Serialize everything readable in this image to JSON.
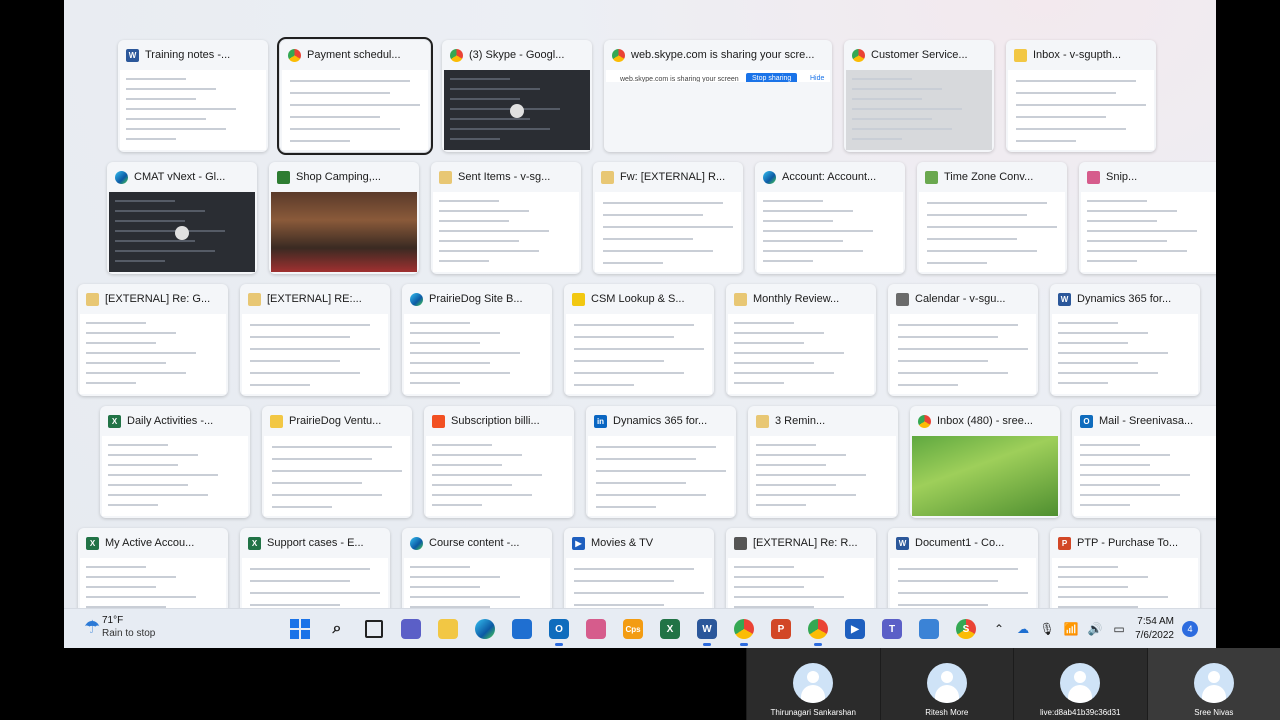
{
  "windows": {
    "row1": [
      {
        "title": "Training notes -...",
        "app": "word-icon",
        "color": "#2b579a",
        "letter": "W"
      },
      {
        "title": "Payment schedul...",
        "app": "chrome-icon",
        "color": "#8a4fd1",
        "letter": "",
        "selected": true
      },
      {
        "title": "(3) Skype - Googl...",
        "app": "chrome-icon",
        "color": "#8a4fd1",
        "letter": "",
        "dark": true
      },
      {
        "title": "web.skype.com is sharing your scre...",
        "app": "chrome-icon",
        "color": "#4285f4",
        "letter": "",
        "wide": true,
        "banner_text": "web.skype.com is sharing your screen",
        "stop_label": "Stop sharing",
        "hide_label": "Hide"
      },
      {
        "title": "Customer Service...",
        "app": "chrome-icon",
        "color": "#4285f4",
        "letter": "",
        "gray": true
      },
      {
        "title": "Inbox - v-sgupth...",
        "app": "folder-icon",
        "color": "#f2c744",
        "letter": ""
      }
    ],
    "row2": [
      {
        "title": "CMAT vNext - Gl...",
        "app": "edge-icon",
        "color": "#0c8ad6",
        "letter": "",
        "dark": true
      },
      {
        "title": "Shop Camping,...",
        "app": "rei-icon",
        "color": "#2e7d32",
        "letter": "",
        "photo": true
      },
      {
        "title": "Sent Items - v-sg...",
        "app": "mail-icon",
        "color": "#e8c774",
        "letter": ""
      },
      {
        "title": "Fw: [EXTERNAL] R...",
        "app": "mail-icon",
        "color": "#e8c774",
        "letter": ""
      },
      {
        "title": "Account: Account...",
        "app": "edge-icon",
        "color": "#0c8ad6",
        "letter": ""
      },
      {
        "title": "Time Zone Conv...",
        "app": "timezone-icon",
        "color": "#6aa84f",
        "letter": ""
      },
      {
        "title": "Snip...",
        "app": "snip-icon",
        "color": "#d65c8c",
        "letter": ""
      }
    ],
    "row3": [
      {
        "title": "[EXTERNAL] Re: G...",
        "app": "mail-icon",
        "color": "#e8c774",
        "letter": ""
      },
      {
        "title": "[EXTERNAL] RE:...",
        "app": "mail-icon",
        "color": "#e8c774",
        "letter": ""
      },
      {
        "title": "PrairieDog Site B...",
        "app": "edge-icon",
        "color": "#0c8ad6",
        "letter": ""
      },
      {
        "title": "CSM Lookup & S...",
        "app": "powerbi-icon",
        "color": "#f2c811",
        "letter": ""
      },
      {
        "title": "Monthly Review...",
        "app": "mail-icon",
        "color": "#e8c774",
        "letter": ""
      },
      {
        "title": "Calendar - v-sgu...",
        "app": "calendar-icon",
        "color": "#6b6b6b",
        "letter": ""
      },
      {
        "title": "Dynamics 365 for...",
        "app": "word-icon",
        "color": "#2b579a",
        "letter": "W"
      }
    ],
    "row4": [
      {
        "title": "Daily Activities -...",
        "app": "excel-icon",
        "color": "#217346",
        "letter": "X"
      },
      {
        "title": "PrairieDog Ventu...",
        "app": "folder-icon",
        "color": "#f2c744",
        "letter": ""
      },
      {
        "title": "Subscription billi...",
        "app": "microsoft-icon",
        "color": "#f25022",
        "letter": ""
      },
      {
        "title": "Dynamics 365 for...",
        "app": "linkedin-icon",
        "color": "#0a66c2",
        "letter": "in"
      },
      {
        "title": "3 Remin...",
        "app": "bell-icon",
        "color": "#e8c774",
        "letter": ""
      },
      {
        "title": "Inbox (480) - sree...",
        "app": "chrome-icon",
        "color": "#4285f4",
        "letter": "",
        "green": true
      },
      {
        "title": "Mail - Sreenivasa...",
        "app": "outlook-icon",
        "color": "#0f6cbd",
        "letter": "O"
      }
    ],
    "row5": [
      {
        "title": "My Active Accou...",
        "app": "excel-icon",
        "color": "#217346",
        "letter": "X"
      },
      {
        "title": "Support cases - E...",
        "app": "excel-icon",
        "color": "#217346",
        "letter": "X"
      },
      {
        "title": "Course content -...",
        "app": "edge-icon",
        "color": "#0c8ad6",
        "letter": ""
      },
      {
        "title": "Movies & TV",
        "app": "movies-icon",
        "color": "#1e5fbf",
        "letter": "▶"
      },
      {
        "title": "[EXTERNAL] Re: R...",
        "app": "document-icon",
        "color": "#555555",
        "letter": ""
      },
      {
        "title": "Document1 - Co...",
        "app": "word-icon",
        "color": "#2b579a",
        "letter": "W"
      },
      {
        "title": "PTP - Purchase To...",
        "app": "powerpoint-icon",
        "color": "#d24726",
        "letter": "P"
      }
    ]
  },
  "taskbar": {
    "weather_temp": "71°F",
    "weather_condition": "Rain to stop",
    "time": "7:54 AM",
    "date": "7/6/2022",
    "notifications": "4",
    "apps": [
      {
        "name": "start-icon",
        "color": "#1a73e8",
        "label": ""
      },
      {
        "name": "search-icon",
        "color": "#222222",
        "label": ""
      },
      {
        "name": "task-view-icon",
        "color": "#222222",
        "label": ""
      },
      {
        "name": "teams-chat-icon",
        "color": "#5b5fc7",
        "label": ""
      },
      {
        "name": "file-explorer-icon",
        "color": "#f2c744",
        "label": ""
      },
      {
        "name": "edge-icon",
        "color": "#0c8ad6",
        "label": ""
      },
      {
        "name": "store-icon",
        "color": "#1f6fd1",
        "label": ""
      },
      {
        "name": "outlook-icon",
        "color": "#0f6cbd",
        "label": "O",
        "active": true
      },
      {
        "name": "snipping-tool-icon",
        "color": "#d65c8c",
        "label": ""
      },
      {
        "name": "cps-icon",
        "color": "#f39c12",
        "label": "Cps"
      },
      {
        "name": "excel-icon",
        "color": "#217346",
        "label": "X"
      },
      {
        "name": "word-icon",
        "color": "#2b579a",
        "label": "W",
        "active": true
      },
      {
        "name": "chrome-icon",
        "color": "#8a4fd1",
        "label": "",
        "active": true
      },
      {
        "name": "powerpoint-icon",
        "color": "#d24726",
        "label": "P"
      },
      {
        "name": "chrome-icon",
        "color": "#4285f4",
        "label": "",
        "active": true
      },
      {
        "name": "movies-icon",
        "color": "#1e5fbf",
        "label": "▶"
      },
      {
        "name": "teams-icon",
        "color": "#5b5fc7",
        "label": "T"
      },
      {
        "name": "notepad-icon",
        "color": "#3b83d6",
        "label": ""
      },
      {
        "name": "chrome-profile-icon",
        "color": "#8a4fd1",
        "label": "S"
      }
    ]
  },
  "participants": [
    {
      "name": "Thirunagari Sankarshan"
    },
    {
      "name": "Ritesh More"
    },
    {
      "name": "live:d8ab41b39c36d31"
    },
    {
      "name": "Sree Nivas"
    }
  ]
}
